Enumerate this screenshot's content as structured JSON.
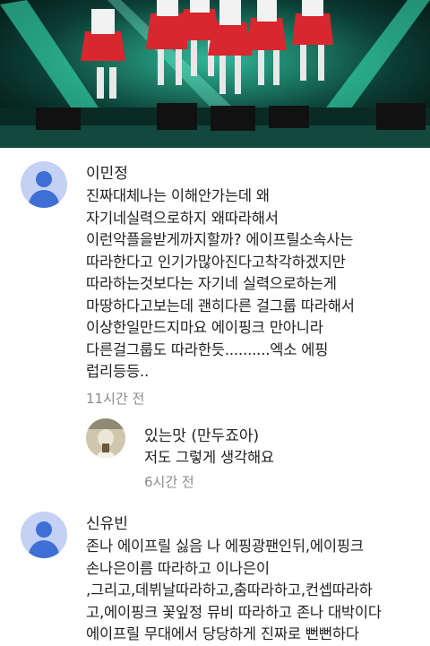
{
  "video": {
    "thumbnail_icon": "concert-stage-thumbnail"
  },
  "comments": [
    {
      "author": "이민정",
      "lines": [
        "진짜대체나는 이해안가는데 왜",
        "자기네실력으로하지 왜따라해서",
        "이런악플을받게까지할까? 에이프릴소속사는",
        "따라한다고 인기가많아진다고착각하겠지만",
        "따라하는것보다는 자기네 실력으로하는게",
        "마땅하다고보는데 괜히다른 걸그룹 따라해서",
        "이상한일만드지마요 에이핑크 만아니라",
        "다른걸그룹도 따라한듯..........엑소 에핑",
        "럽리등등.."
      ],
      "time": "11시간 전",
      "reply": {
        "author": "있는맛 (만두죠아)",
        "text": "저도 그렇게 생각해요",
        "time": "6시간 전"
      }
    },
    {
      "author": "신유빈",
      "lines": [
        "존나 에이프릴 싫음 나 에핑광팬인뒤,에이핑크",
        "손나은이름 따라하고 이나은이",
        ",그리고,데뷔날따라하고,춤따라하고,컨셉따라하",
        "고,에이핑크 꽃잎정 뮤비 따라하고 존나 대박이다",
        "에이프릴 무대에서 당당하게 진짜로 뻔뻔하다"
      ]
    }
  ]
}
